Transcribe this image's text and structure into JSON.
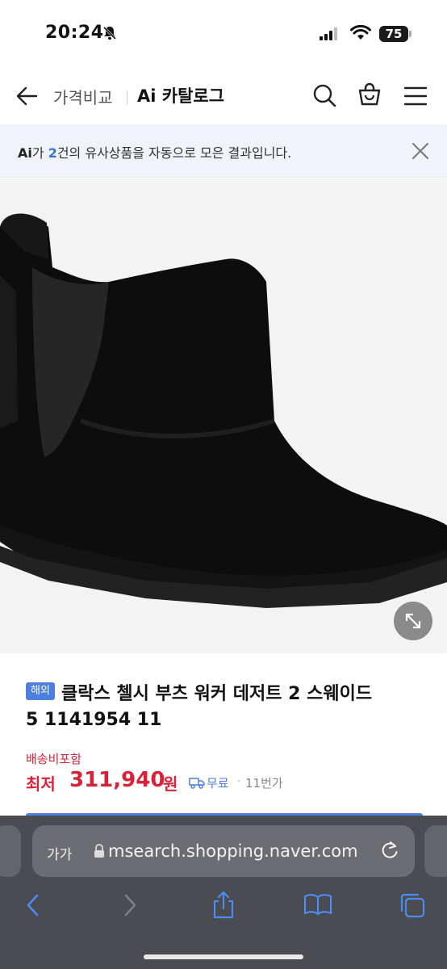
{
  "status_bar": {
    "time": "20:24",
    "battery": "75"
  },
  "header": {
    "breadcrumb": "가격비교",
    "title": "Ai 카탈로그"
  },
  "notice": {
    "ai_label": "Ai",
    "prefix": "가 ",
    "count": "2",
    "suffix": "건의 유사상품을 자동으로 모은 결과입니다."
  },
  "product": {
    "badge": "해외",
    "name_line1": "클락스 첼시 부츠 워커 데저트 2 스웨이드",
    "name_line2": "5 1141954 11",
    "shipping_included": "배송비포함",
    "lowest_label": "최저",
    "price": "311,940",
    "currency": "원",
    "shipping": "무료",
    "sellers": "11번가"
  },
  "safari": {
    "text_size": "가가",
    "url": "msearch.shopping.naver.com"
  },
  "colors": {
    "accent_blue": "#4d7fe0",
    "price_red": "#d8223a",
    "notice_bg": "#f0f4fa",
    "safari_bg": "#4a4c51"
  }
}
